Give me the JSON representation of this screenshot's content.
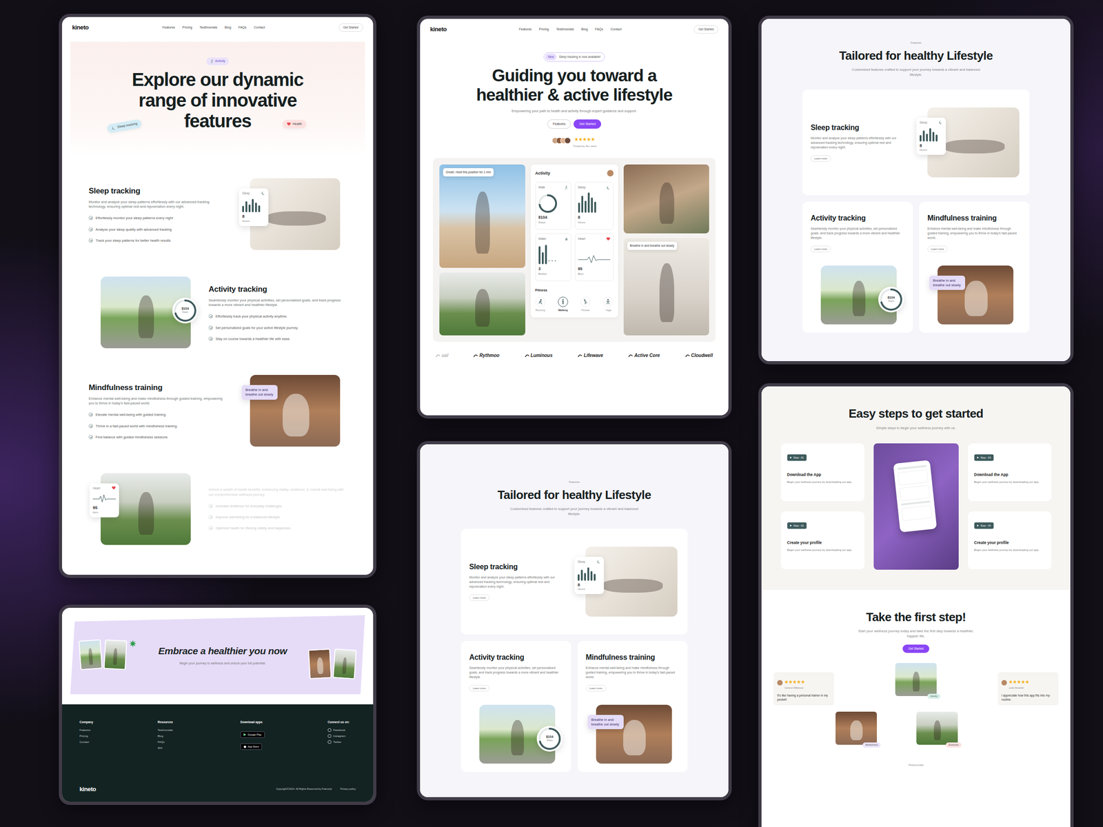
{
  "explore": {
    "nav": {
      "logo": "kineto",
      "links": [
        "Features",
        "Pricing",
        "Testimonials",
        "Blog",
        "FAQs",
        "Contact"
      ],
      "button": "Get Started"
    },
    "badge": "Activity",
    "title_lines": [
      "Explore our dynamic",
      "range of innovative",
      "features"
    ],
    "tags": [
      {
        "label": "Sleep tracking",
        "color": "#d4ecf6"
      },
      {
        "label": "Health",
        "color": "#fde1e0"
      }
    ],
    "features": [
      {
        "title": "Sleep tracking",
        "desc": "Monitor and analyze your sleep patterns effortlessly with our advanced tracking technology, ensuring optimal rest and rejuvenation every night.",
        "bullets": [
          "Effortlessly monitor your sleep patterns every night",
          "Analyze your sleep quality with advanced tracking",
          "Track your sleep patterns for better health results"
        ],
        "faded": false,
        "visual": {
          "kind": "bars",
          "label": "Sleep",
          "value": "8",
          "unit": "Hours",
          "bars": [
            0.45,
            0.8,
            0.55,
            0.95,
            0.7,
            0.5
          ]
        }
      },
      {
        "title": "Activity tracking",
        "desc": "Seamlessly monitor your physical activities, set personalized goals, and track progress towards a more vibrant and healthier lifestyle.",
        "bullets": [
          "Effortlessly track your physical activity anytime.",
          "Set personalized goals for your active lifestyle journey.",
          "Stay on course towards a healthier life with ease."
        ],
        "faded": false,
        "visual": {
          "kind": "ring",
          "value": "8104",
          "unit": "Steps",
          "level": 0.7
        }
      },
      {
        "title": "Mindfulness training",
        "desc": "Enhance mental well-being and make mindfulness through guided training, empowering you to thrive in today's fast-paced world.",
        "bullets": [
          "Elevate mental well-being with guided training.",
          "Thrive in a fast-paced world with mindfulness training.",
          "Find balance with guided mindfulness sessions."
        ],
        "faded": false,
        "visual": {
          "kind": "bubble",
          "text": "Breathe in and breathe out slowly"
        }
      },
      {
        "desc": "Unlock a wealth of health benefits, enhancing vitality, resilience, & overall well-being with our comprehensive wellness journey.",
        "bullets": [
          "Increase resilience for everyday challenges.",
          "Improve well-being for a balanced lifestyle.",
          "Optimize health for lifelong vitality and happiness."
        ],
        "faded": true,
        "visual": {
          "kind": "heart",
          "label": "Heart",
          "value": "95",
          "unit": "bpm"
        }
      }
    ]
  },
  "cta": {
    "title": "Embrace a healthier you now",
    "subtitle": "Begin your journey to wellness and unlock your full potential.",
    "footer": {
      "columns": [
        {
          "heading": "Company",
          "kind": "links",
          "links": [
            "Features",
            "Pricing",
            "Contact"
          ]
        },
        {
          "heading": "Resources",
          "kind": "links",
          "links": [
            "Testimonials",
            "Blog",
            "FAQs",
            "404"
          ]
        },
        {
          "heading": "Download apps",
          "kind": "stores",
          "links": [
            "Google Play",
            "App Store"
          ]
        },
        {
          "heading": "Connect us on:",
          "kind": "social",
          "links": [
            "Facebook",
            "Instagram",
            "Twitter"
          ]
        }
      ],
      "logo": "kineto",
      "copyright": "Copyright©2024. All Rights Reserved by Framerfy",
      "policy": "Privacy policy"
    }
  },
  "hero": {
    "nav": {
      "logo": "kineto",
      "links": [
        "Features",
        "Pricing",
        "Testimonials",
        "Blog",
        "FAQs",
        "Contact"
      ],
      "button": "Get Started"
    },
    "announcement": {
      "tag": "New",
      "text": "Sleep tracking is now available!"
    },
    "title_lines": [
      "Guiding you toward a",
      "healthier & active lifestyle"
    ],
    "subtitle": "Empowering your path to health and activity through expert guidance and support.",
    "buttons": [
      {
        "label": "Features",
        "kind": "outline"
      },
      {
        "label": "Get Started",
        "kind": "primary"
      }
    ],
    "rating": {
      "stars": 5,
      "text": "Trusted by 4k+ users"
    },
    "mosaic": {
      "coach_bubble": "Great!, Hold this position for 1 min",
      "breath_bubble": "Breathe in and breathe out slowly",
      "app": {
        "title": "Activity",
        "tiles": [
          {
            "label": "Walk",
            "kind": "ring",
            "level": 0.72,
            "value": "8104",
            "unit": "Steps"
          },
          {
            "label": "Sleep",
            "kind": "bars",
            "bars": [
              0.5,
              0.85,
              0.6,
              1,
              0.75,
              0.55
            ],
            "value": "8",
            "unit": "Hours"
          },
          {
            "label": "Water",
            "kind": "dots",
            "bars": [
              0.9,
              0.6,
              0.95
            ],
            "dots": 3,
            "value": "3",
            "unit": "Bottles"
          },
          {
            "label": "Heart",
            "kind": "pulse",
            "value": "95",
            "unit": "Bpm"
          }
        ],
        "section": "Fitness",
        "modes": [
          {
            "label": "Running",
            "selected": false
          },
          {
            "label": "Walking",
            "selected": true
          },
          {
            "label": "Fitness",
            "selected": false
          },
          {
            "label": "Yoga",
            "selected": false
          }
        ]
      }
    },
    "logos": [
      "ual",
      "Rythmoo",
      "Luminous",
      "Lifewave",
      "Active Core",
      "Cloudwell"
    ]
  },
  "tailored_1": {
    "eyebrow": "Features",
    "title": "Tailored for healthy Lifestyle",
    "subtitle": "Customized features crafted to support your journey towards a vibrant and balanced lifestyle.",
    "cards": [
      {
        "title": "Sleep tracking",
        "desc": "Monitor and analyze your sleep patterns effortlessly with our advanced tracking technology, ensuring optimal rest and rejuvenation every night.",
        "link": "Learn more",
        "visual": {
          "kind": "bars",
          "label": "Sleep",
          "value": "8",
          "unit": "Hours",
          "bars": [
            0.45,
            0.8,
            0.55,
            0.95,
            0.7,
            0.5
          ]
        }
      },
      {
        "title": "Activity tracking",
        "desc": "Seamlessly monitor your physical activities, set personalized goals, and track progress towards a more vibrant and healthier lifestyle.",
        "link": "Learn more",
        "visual": {
          "kind": "ring",
          "value": "8104",
          "unit": "Steps",
          "level": 0.7
        }
      },
      {
        "title": "Mindfulness training",
        "desc": "Enhance mental well-being and make mindfulness through guided training, empowering you to thrive in today's fast-paced world.",
        "link": "Learn more",
        "visual": {
          "kind": "bubble",
          "text": "Breathe in and breathe out slowly"
        }
      }
    ]
  },
  "tailored_2": {
    "eyebrow": "Features",
    "title": "Tailored for healthy Lifestyle",
    "subtitle": "Customized features crafted to support your journey towards a vibrant and balanced lifestyle.",
    "cards": [
      {
        "title": "Sleep tracking",
        "desc": "Monitor and analyze your sleep patterns effortlessly with our advanced tracking technology, ensuring optimal rest and rejuvenation every night.",
        "link": "Learn more",
        "visual": {
          "kind": "bars",
          "label": "Sleep",
          "value": "8",
          "unit": "Hours",
          "bars": [
            0.45,
            0.8,
            0.55,
            0.95,
            0.7,
            0.5
          ]
        }
      },
      {
        "title": "Activity tracking",
        "desc": "Seamlessly monitor your physical activities, set personalized goals, and track progress towards a more vibrant and healthier lifestyle.",
        "link": "Learn more",
        "visual": {
          "kind": "ring",
          "value": "8104",
          "unit": "Steps",
          "level": 0.7
        }
      },
      {
        "title": "Mindfulness training",
        "desc": "Enhance mental well-being and make mindfulness through guided training, empowering you to thrive in today's fast-paced world.",
        "link": "Learn more",
        "visual": {
          "kind": "bubble",
          "text": "Breathe in and breathe out slowly"
        }
      }
    ]
  },
  "steps": {
    "title": "Easy steps to get started",
    "subtitle": "Simple steps to begin your wellness journey with us.",
    "steps": [
      {
        "tag": "Step - 01",
        "title": "Download the App",
        "desc": "Begin your wellness journey by downloading our app."
      },
      {
        "tag": "Step - 02",
        "title": "Create your profile",
        "desc": "Begin your wellness journey by downloading our app."
      },
      {
        "tag": "Step - 03",
        "title": "Download the App",
        "desc": "Begin your wellness journey by downloading our app."
      },
      {
        "tag": "Step - 04",
        "title": "Create your profile",
        "desc": "Begin your wellness journey by downloading our app."
      }
    ],
    "cta": {
      "title": "Take the first step!",
      "subtitle": "Start your wellness journey today and take the first step towards a healthier, happier life.",
      "button": "Get Started"
    },
    "testimonials": [
      {
        "name": "Cameron Williamson",
        "stars": 5,
        "quote": "It's like having a personal trainer in my pocket!"
      },
      {
        "name": "Leslie Alexander",
        "stars": 5,
        "quote": "I appreciate how this app fits into my routine."
      }
    ],
    "photo_tags": [
      {
        "label": "Activity",
        "color": "#d7f0ea"
      },
      {
        "label": "Mindfulness",
        "color": "#ece4fb"
      },
      {
        "label": "Exercises",
        "color": "#fde2e2"
      }
    ],
    "footer_label": "Testimonials"
  }
}
